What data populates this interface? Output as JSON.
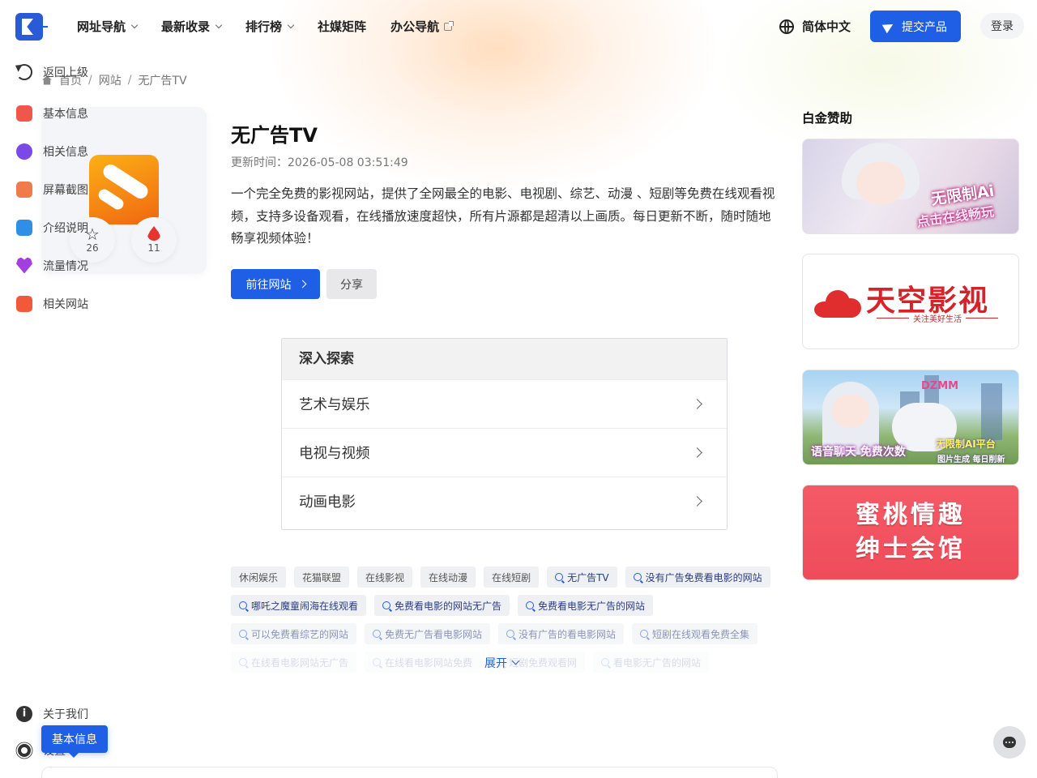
{
  "header": {
    "nav": [
      {
        "label": "网址导航",
        "has_dropdown": true
      },
      {
        "label": "最新收录",
        "has_dropdown": true
      },
      {
        "label": "排行榜",
        "has_dropdown": true
      },
      {
        "label": "社媒矩阵",
        "has_dropdown": false
      },
      {
        "label": "办公导航",
        "has_dropdown": false,
        "external": true
      }
    ],
    "language": "简体中文",
    "submit_label": "提交产品",
    "login_label": "登录",
    "accent_color": "#1f5fe6"
  },
  "sidebar": {
    "back_label": "返回上级",
    "items": [
      {
        "label": "基本信息",
        "icon": "basic-info-icon",
        "color": "#f0564a"
      },
      {
        "label": "相关信息",
        "icon": "compass-icon",
        "color": "#7b4ae6"
      },
      {
        "label": "屏幕截图",
        "icon": "screenshot-icon",
        "color": "#f07a4a"
      },
      {
        "label": "介绍说明",
        "icon": "document-icon",
        "color": "#2f8fe6"
      },
      {
        "label": "流量情况",
        "icon": "heart-pulse-icon",
        "color": "#a33ee0"
      },
      {
        "label": "相关网站",
        "icon": "video-icon",
        "color": "#f05a3a"
      }
    ],
    "about_label": "关于我们",
    "settings_label": "设置",
    "tooltip": "基本信息"
  },
  "breadcrumb": {
    "items": [
      "首页",
      "网站",
      "无广告TV"
    ],
    "separator": "/"
  },
  "site": {
    "title": "无广告TV",
    "update_time": "更新时间：2026-05-08 03:51:49",
    "description": "一个完全免费的影视网站，提供了全网最全的电影、电视剧、综艺、动漫 、短剧等免费在线观看视频，支持多设备观看，在线播放速度超快，所有片源都是超清以上画质。每日更新不断，随时随地畅享视频体验！",
    "favorites": "26",
    "hot": "11",
    "go_label": "前往网站",
    "share_label": "分享"
  },
  "explore": {
    "title": "深入探索",
    "rows": [
      "艺术与娱乐",
      "电视与视频",
      "动画电影"
    ]
  },
  "tags": {
    "rows": [
      [
        {
          "label": "休闲娱乐",
          "search": false
        },
        {
          "label": "花猫联盟",
          "search": false
        },
        {
          "label": "在线影视",
          "search": false
        },
        {
          "label": "在线动漫",
          "search": false
        },
        {
          "label": "在线短剧",
          "search": false
        },
        {
          "label": "无广告TV",
          "search": true
        },
        {
          "label": "没有广告免费看电影的网站",
          "search": true
        }
      ],
      [
        {
          "label": "哪吒之魔童闹海在线观看",
          "search": true
        },
        {
          "label": "免费看电影的网站无广告",
          "search": true
        },
        {
          "label": "免费看电影无广告的网站",
          "search": true
        }
      ],
      [
        {
          "label": "可以免费看综艺的网站",
          "search": true
        },
        {
          "label": "免费无广告看电影网站",
          "search": true
        },
        {
          "label": "没有广告的看电影网站",
          "search": true
        },
        {
          "label": "短剧在线观看免费全集",
          "search": true
        }
      ],
      [
        {
          "label": "在线看电影网站无广告",
          "search": true
        },
        {
          "label": "在线看电影网站免费",
          "search": true
        },
        {
          "label": "短剧免费观看网",
          "search": true
        },
        {
          "label": "看电影无广告的网站",
          "search": true
        }
      ]
    ],
    "expand_label": "展开"
  },
  "sponsors": {
    "title": "白金赞助",
    "ad1_caption_a": "无限制Ai",
    "ad1_caption_b": "点击在线畅玩",
    "ad2_title": "天空影视",
    "ad2_sub": "关注美好生活",
    "ad3_brand": "DZMM",
    "ad3_caption_a": "语音聊天 免费次数",
    "ad3_caption_b": "无限制AI平台",
    "ad3_caption_c": "图片生成 每日削新",
    "ad4_line1": "蜜桃情趣",
    "ad4_line2": "绅士会馆"
  }
}
